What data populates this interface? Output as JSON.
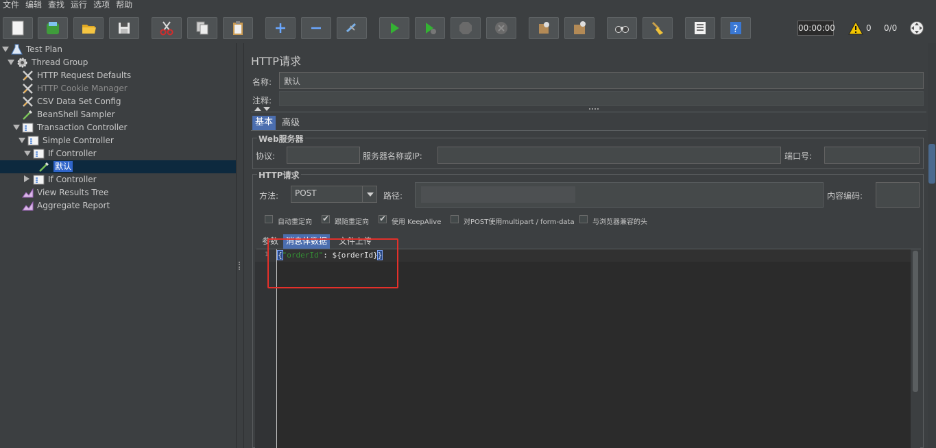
{
  "menu": [
    "文件",
    "编辑",
    "查找",
    "运行",
    "选项",
    "帮助"
  ],
  "toolbar": {
    "timer": "00:00:00",
    "warning_count": "0",
    "thread_count": "0/0"
  },
  "tree": [
    {
      "label": "Test Plan",
      "icon": "flask-icon",
      "level": 0,
      "expander": "down"
    },
    {
      "label": "Thread Group",
      "icon": "gear-icon",
      "level": 1,
      "expander": "down"
    },
    {
      "label": "HTTP Request Defaults",
      "icon": "wrench-icon",
      "level": 2
    },
    {
      "label": "HTTP Cookie Manager",
      "icon": "wrench-icon",
      "level": 2,
      "disabled": true
    },
    {
      "label": "CSV Data Set Config",
      "icon": "wrench-icon",
      "level": 2
    },
    {
      "label": "BeanShell Sampler",
      "icon": "pipette-icon",
      "level": 2
    },
    {
      "label": "Transaction Controller",
      "icon": "controller-icon",
      "level": 2,
      "expander": "down"
    },
    {
      "label": "Simple Controller",
      "icon": "controller-icon",
      "level": 3,
      "expander": "down"
    },
    {
      "label": "If Controller",
      "icon": "controller-icon",
      "level": 4,
      "expander": "down"
    },
    {
      "label": "默认",
      "icon": "pipette-icon",
      "level": 5,
      "selected": true
    },
    {
      "label": "If Controller",
      "icon": "controller-icon",
      "level": 4,
      "expander": "right"
    },
    {
      "label": "View Results Tree",
      "icon": "chart-icon",
      "level": 2
    },
    {
      "label": "Aggregate Report",
      "icon": "chart-icon",
      "level": 2
    }
  ],
  "panel": {
    "title": "HTTP请求",
    "name_label": "名称:",
    "name_value": "默认",
    "comment_label": "注释:",
    "comment_value": "",
    "tabs": [
      "基本",
      "高级"
    ],
    "web_server": {
      "title": "Web服务器",
      "protocol_label": "协议:",
      "protocol_value": "",
      "server_label": "服务器名称或IP:",
      "server_value": "",
      "port_label": "端口号:",
      "port_value": ""
    },
    "http_request": {
      "title": "HTTP请求",
      "method_label": "方法:",
      "method_value": "POST",
      "path_label": "路径:",
      "encoding_label": "内容编码:",
      "encoding_value": ""
    },
    "checkboxes": [
      {
        "label": "自动重定向",
        "checked": false
      },
      {
        "label": "跟随重定向",
        "checked": true
      },
      {
        "label": "使用 KeepAlive",
        "checked": true
      },
      {
        "label": "对POST使用multipart / form-data",
        "checked": false
      },
      {
        "label": "与浏览器兼容的头",
        "checked": false
      }
    ],
    "body_tabs": [
      "参数",
      "消息体数据",
      "文件上传"
    ],
    "editor": {
      "line_number": "1",
      "open_brace": "{",
      "key": "\"orderId\"",
      "colon": ": ",
      "value": "${orderId}"
    }
  },
  "colors": {
    "accent": "#4b6eaf",
    "selection": "#2f65ca",
    "annotation": "#e5302a",
    "key_green": "#2e8b2e"
  }
}
